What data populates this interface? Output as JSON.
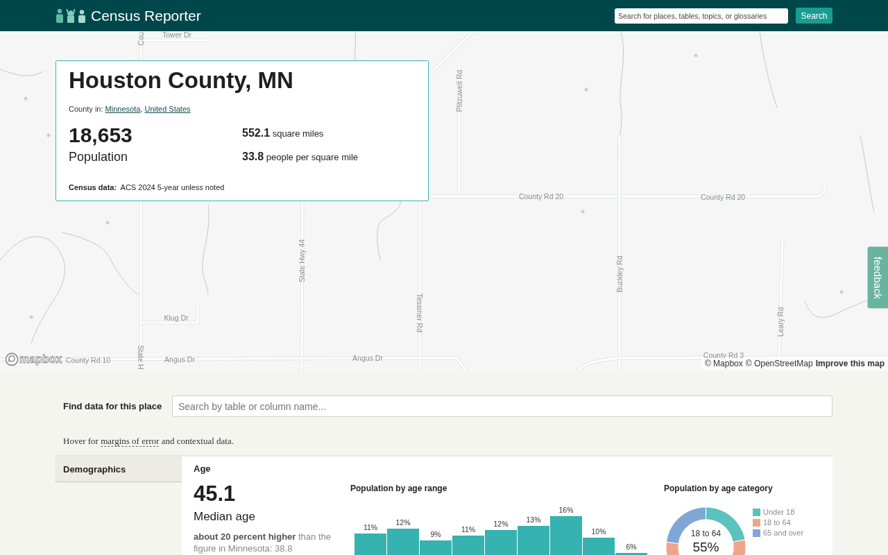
{
  "header": {
    "logo_text": "Census Reporter",
    "search": {
      "placeholder": "Search for places, tables, topics, or glossaries"
    },
    "search_button": "Search"
  },
  "map": {
    "road_labels": [
      "Tower Dr",
      "Cou",
      "Plitzuweit Rd",
      "County Rd 20",
      "County Rd 20",
      "State Hwy 44",
      "Tessmer Rd",
      "Buckley Rd",
      "Leary Rd",
      "Klug Dr",
      "State H",
      "County Rd 10",
      "Angus Dr",
      "Angus Dr",
      "County Rd 3"
    ],
    "logo_text": "mapbox",
    "attribution": [
      {
        "label": "© Mapbox",
        "kind": "credit"
      },
      {
        "label": "© OpenStreetMap",
        "kind": "credit"
      },
      {
        "label": "Improve this map",
        "kind": "action"
      }
    ],
    "feedback_tab": "feedback"
  },
  "place_card": {
    "title": "Houston County, MN",
    "parent_prefix": "County in:",
    "parents": [
      "Minnesota",
      "United States"
    ],
    "parent_separator": ",",
    "population": "18,653",
    "population_label": "Population",
    "stats": [
      {
        "value": "552.1",
        "label": "square miles"
      },
      {
        "value": "33.8",
        "label": "people per square mile"
      }
    ],
    "source_label": "Census data:",
    "source": "ACS 2024 5-year unless noted"
  },
  "find_data": {
    "label": "Find data for this place",
    "search": {
      "placeholder": "Search by table or column name..."
    }
  },
  "hover_note": {
    "before": "Hover for ",
    "term": "margins of error",
    "after": " and contextual data."
  },
  "sidebar": {
    "items": [
      {
        "label": "Demographics",
        "selected": true
      }
    ]
  },
  "age": {
    "title": "Age",
    "median": "45.1",
    "median_label": "Median age",
    "comparison": "**about 20 percent higher** than the figure in Minnesota: 38.8",
    "age_range": {
      "title": "Population by age range",
      "bar_labels": [
        "11%",
        "12%",
        "9%",
        "11%",
        "12%",
        "13%",
        "16%",
        "10%",
        "6%"
      ]
    },
    "age_category": {
      "chart_data": {
        "type": "donut",
        "title": "Population by age category",
        "categories": [
          "Under 18",
          "18 to 64",
          "65 and over"
        ],
        "values": [
          22,
          55,
          23
        ],
        "colors": [
          "#5bc2bd",
          "#f0a58a",
          "#80a6d6"
        ],
        "legend": "right"
      },
      "center_label": "18 to 64",
      "center_value": "55%"
    }
  }
}
